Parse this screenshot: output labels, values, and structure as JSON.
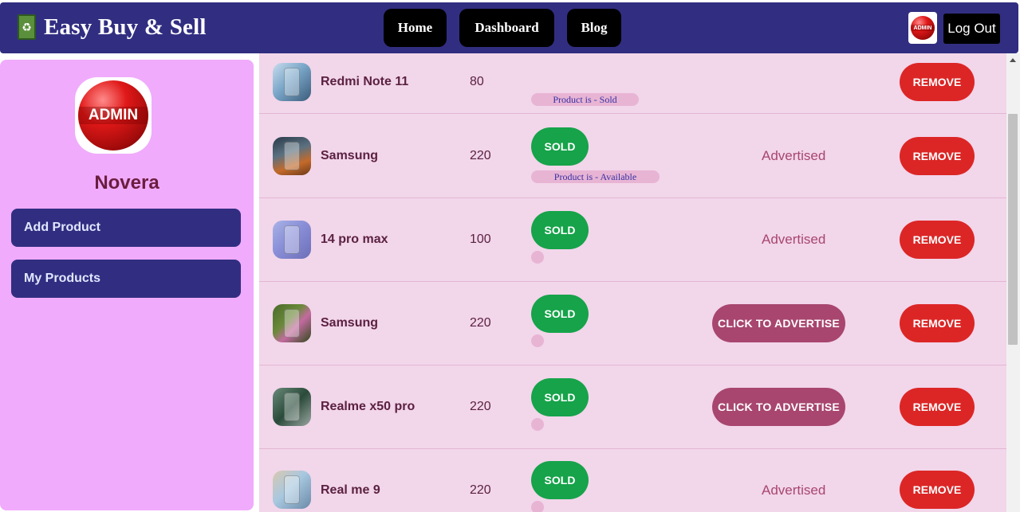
{
  "header": {
    "brand_icon": "recycle-bag-icon",
    "brand_title": "Easy Buy & Sell",
    "nav": [
      "Home",
      "Dashboard",
      "Blog"
    ],
    "avatar_text": "ADMIN",
    "logout_label": "Log Out"
  },
  "sidebar": {
    "avatar_text": "ADMIN",
    "user_name": "Novera",
    "items": [
      "Add Product",
      "My Products"
    ]
  },
  "products": [
    {
      "name": "Redmi Note 11",
      "price": "80",
      "sold_label": "",
      "status": "Product is - Sold",
      "advertise": "",
      "remove": "REMOVE"
    },
    {
      "name": "Samsung",
      "price": "220",
      "sold_label": "SOLD",
      "status": "Product is - Available",
      "advertise": "Advertised",
      "remove": "REMOVE"
    },
    {
      "name": "14 pro max",
      "price": "100",
      "sold_label": "SOLD",
      "status": "",
      "advertise": "Advertised",
      "remove": "REMOVE"
    },
    {
      "name": "Samsung",
      "price": "220",
      "sold_label": "SOLD",
      "status": "",
      "advertise_button": "CLICK TO ADVERTISE",
      "remove": "REMOVE"
    },
    {
      "name": "Realme x50 pro",
      "price": "220",
      "sold_label": "SOLD",
      "status": "",
      "advertise_button": "CLICK TO ADVERTISE",
      "remove": "REMOVE"
    },
    {
      "name": "Real me 9",
      "price": "220",
      "sold_label": "SOLD",
      "status": "",
      "advertise": "Advertised",
      "remove": "REMOVE"
    }
  ],
  "colors": {
    "navbar": "#312e81",
    "sidebar": "#f0abfc",
    "main_bg": "#f2d6ea",
    "sold": "#16a34a",
    "remove": "#dc2626",
    "advertise": "#a8466f"
  }
}
